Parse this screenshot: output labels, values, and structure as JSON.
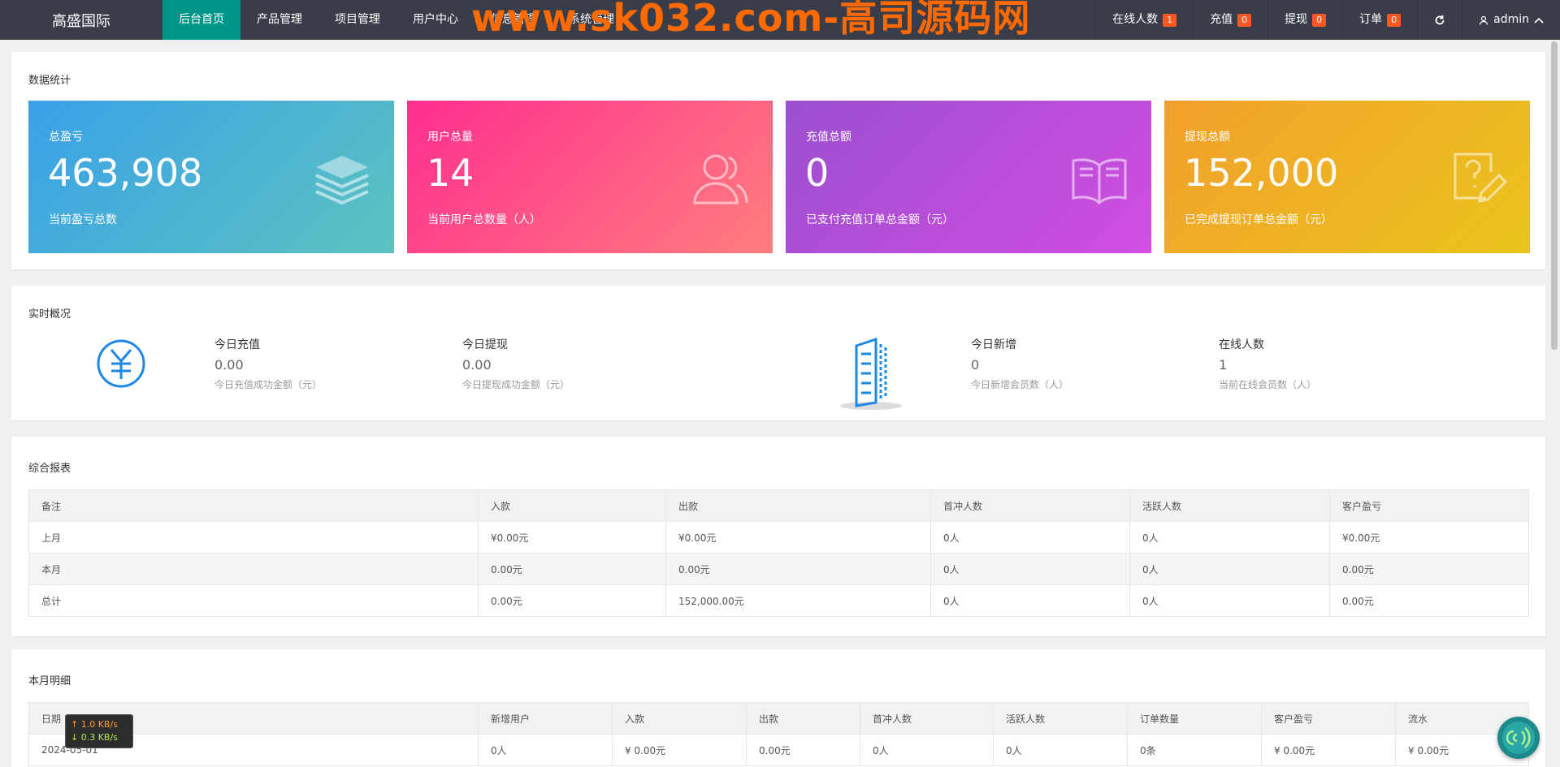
{
  "topbar": {
    "logo": "高盛国际",
    "nav": [
      "后台首页",
      "产品管理",
      "项目管理",
      "用户中心",
      "信息管理",
      "系统管理"
    ],
    "watermark": "www.sk032.com-高司源码网",
    "right": [
      {
        "label": "在线人数",
        "badge": "1"
      },
      {
        "label": "充值",
        "badge": "0"
      },
      {
        "label": "提现",
        "badge": "0"
      },
      {
        "label": "订单",
        "badge": "0"
      }
    ],
    "user": "admin",
    "colors": {
      "bar": "#393d49",
      "active": "#009688",
      "badge": "#ff5722"
    }
  },
  "stats": {
    "title": "数据统计",
    "cards": [
      {
        "label": "总盈亏",
        "value": "463,908",
        "sub": "当前盈亏总数",
        "icon": "layers-icon",
        "gradient": [
          "#3aa1e8",
          "#5cc3c0"
        ]
      },
      {
        "label": "用户总量",
        "value": "14",
        "sub": "当前用户总数量（人）",
        "icon": "users-icon",
        "gradient": [
          "#ff2e8f",
          "#ff7e7e"
        ]
      },
      {
        "label": "充值总额",
        "value": "0",
        "sub": "已支付充值订单总金额（元）",
        "icon": "book-icon",
        "gradient": [
          "#9b4fd1",
          "#d24ee0"
        ]
      },
      {
        "label": "提现总额",
        "value": "152,000",
        "sub": "已完成提现订单总金额（元）",
        "icon": "edit-doc-icon",
        "gradient": [
          "#f2a02c",
          "#eac41c"
        ]
      }
    ]
  },
  "realtime": {
    "title": "实时概况",
    "items": [
      {
        "label": "今日充值",
        "value": "0.00",
        "sub": "今日充值成功金额（元）"
      },
      {
        "label": "今日提现",
        "value": "0.00",
        "sub": "今日提现成功金额（元）"
      },
      {
        "label": "今日新增",
        "value": "0",
        "sub": "今日新增会员数（人）"
      },
      {
        "label": "在线人数",
        "value": "1",
        "sub": "当前在线会员数（人）"
      }
    ],
    "icons": [
      "yuan-icon",
      "building-icon"
    ]
  },
  "report": {
    "title": "综合报表",
    "headers": [
      "备注",
      "入款",
      "出款",
      "首冲人数",
      "活跃人数",
      "客户盈亏"
    ],
    "rows": [
      [
        "上月",
        "¥0.00元",
        "¥0.00元",
        "0人",
        "0人",
        "¥0.00元"
      ],
      [
        "本月",
        "0.00元",
        "0.00元",
        "0人",
        "0人",
        "0.00元"
      ],
      [
        "总计",
        "0.00元",
        "152,000.00元",
        "0人",
        "0人",
        "0.00元"
      ]
    ]
  },
  "detail": {
    "title": "本月明细",
    "headers": [
      "日期",
      "新增用户",
      "入款",
      "出款",
      "首冲人数",
      "活跃人数",
      "订单数量",
      "客户盈亏",
      "流水"
    ],
    "rows": [
      [
        "2024-05-01",
        "0人",
        "¥ 0.00元",
        "0.00元",
        "0人",
        "0人",
        "0条",
        "¥ 0.00元",
        "¥ 0.00元"
      ]
    ]
  },
  "network": {
    "up": "↑ 1.0 KB/s",
    "down": "↓ 0.3 KB/s"
  }
}
